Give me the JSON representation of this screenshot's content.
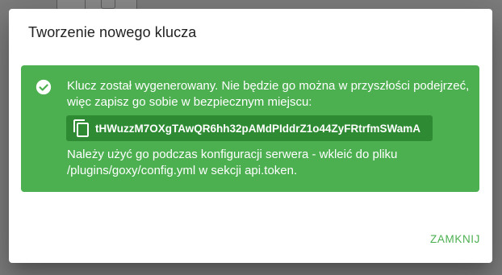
{
  "dialog": {
    "title": "Tworzenie nowego klucza",
    "alert": {
      "icon": "check-circle-icon",
      "message": "Klucz został wygenerowany. Nie będzie go można w przyszłości podejrzeć, więc zapisz go sobie w bezpiecznym miejscu:",
      "token": {
        "icon": "copy-icon",
        "value": "tHWuzzM7OXgTAwQR6hh32pAMdPIddrZ1o44ZyFRtrfmSWamA"
      },
      "note": "Należy użyć go podczas konfiguracji serwera - wkleić do pliku /plugins/goxy/config.yml w sekcji api.token."
    },
    "actions": {
      "close_label": "ZAMKNIJ"
    }
  },
  "colors": {
    "success": "#4caf50",
    "token_background": "#2e8b33",
    "scrim": "#7e7e7e"
  }
}
